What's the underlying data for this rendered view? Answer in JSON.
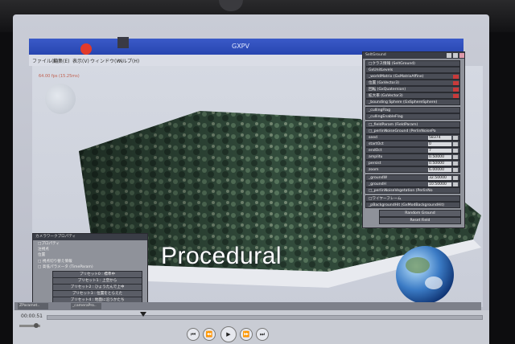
{
  "window": {
    "title": "GXPV"
  },
  "menu": [
    "ファイル(F)",
    "編集(E)",
    "表示(V)",
    "ウィンドウ(W)",
    "ヘルプ(H)"
  ],
  "viewport": {
    "fps": "64.00 fps (15.25ms)",
    "overlay_text": "Procedural"
  },
  "right_panel": {
    "title": "SeltGround",
    "rows": [
      "□クラス情報 (SeltGround)",
      "GxUnitLevels",
      "_worldMatrix (GxMatrixAffine)",
      "位置 (GxVector3)",
      "回転 (GxQuaternion)",
      "拡大率 (GxVector3)",
      "_bounding Sphere (GxSphereSphere)",
      "_cullingFlag",
      "_cullingEnableFlag",
      "□_fieldParam (FieldParam)",
      "□_perlinNoiseGround (PerlinNoisePa",
      "seed",
      "startOct",
      "endOct",
      "amplitu",
      "persist",
      "zoom",
      "_groundW",
      "_groundH",
      "□_perlinNoiseVegetation (PerlinNo",
      "□ワイヤーフレーム",
      "_pBackgroundHit (GxModBackgroundHit)"
    ],
    "values": [
      "58374",
      "0",
      "7",
      "0.50000",
      "0.50000",
      "6.00000",
      "32.50000",
      "10.50000"
    ],
    "buttons": [
      "Random Ground",
      "Reset Field"
    ]
  },
  "left_panel": {
    "title": "カメラワークプロパティ",
    "rows": [
      "□プロパティ",
      "注視点",
      "位置",
      "□ 視点切り替え情報",
      "□ 高低パラメータ (TimeParam)"
    ],
    "buttons": [
      "プリセット0 : 標準中",
      "プリセット1 : 上空から",
      "プリセット2 : ひょうたんで上中",
      "プリセット3 : 位置をとらえた",
      "プリセット4 : 地面に沿うかたち"
    ]
  },
  "taskbar": [
    "ZParamet..",
    "_cameraPro.."
  ],
  "player": {
    "time": "00:00:51"
  }
}
